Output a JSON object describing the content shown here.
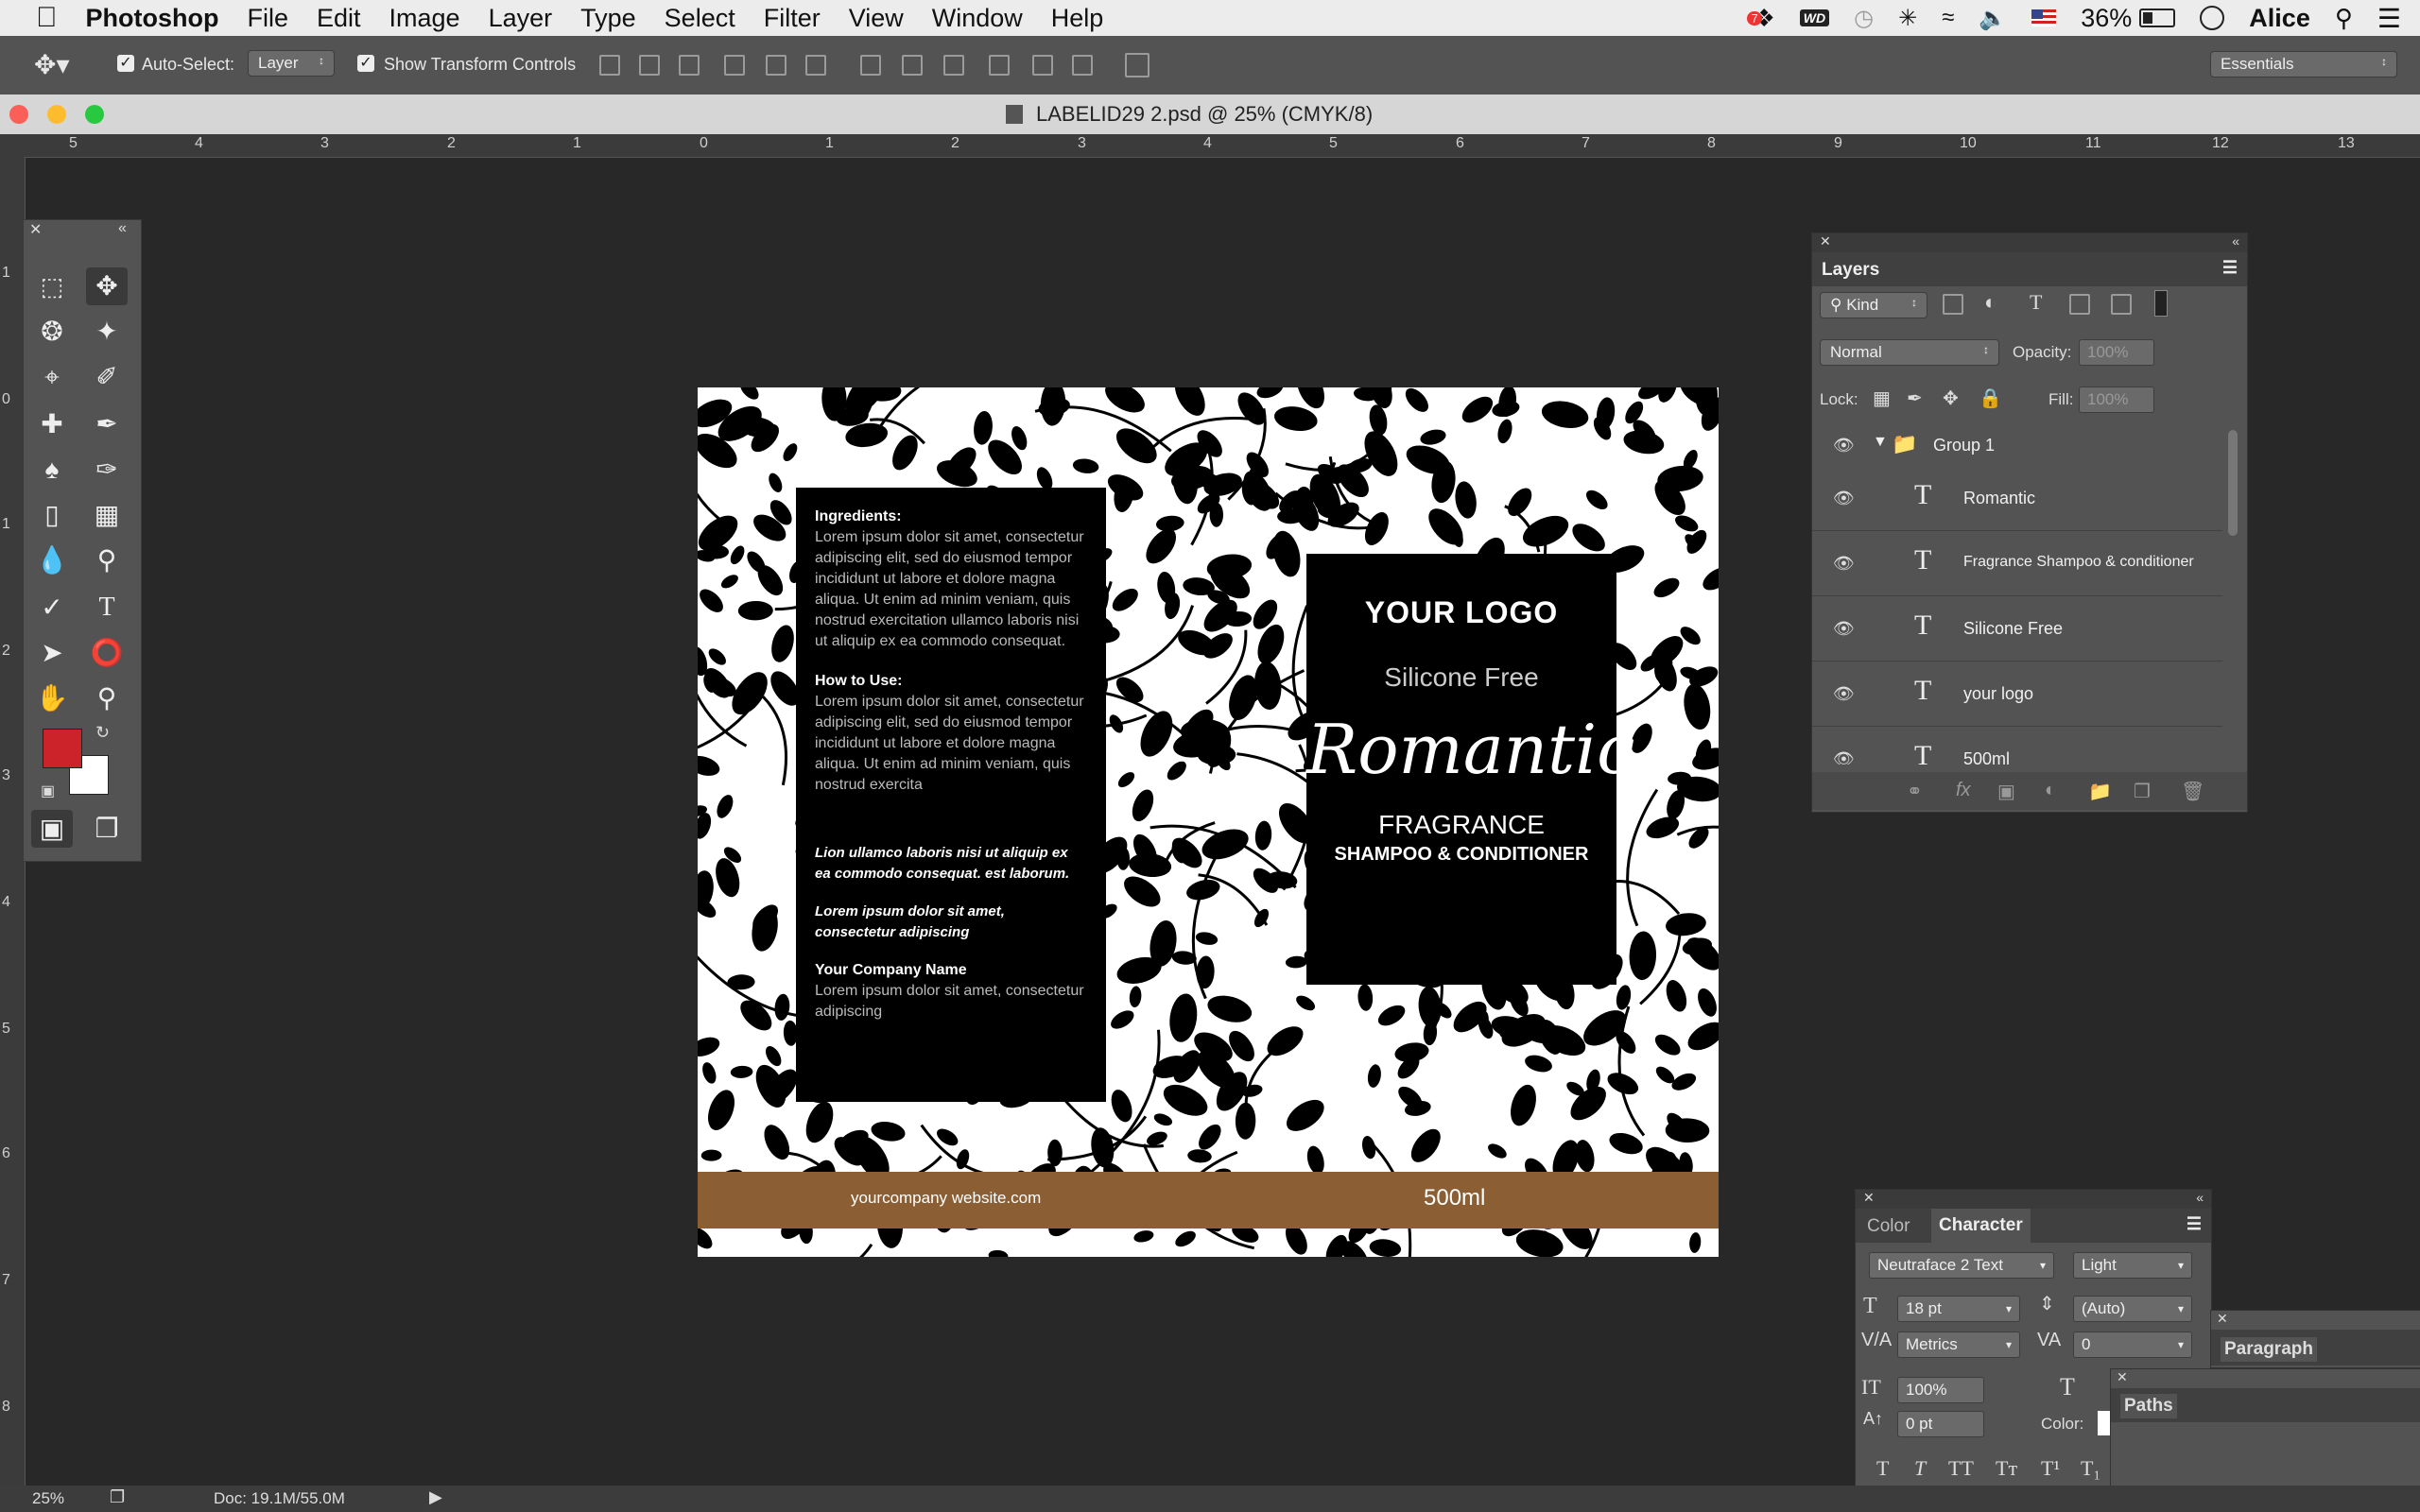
{
  "menubar": {
    "app_name": "Photoshop",
    "items": [
      "File",
      "Edit",
      "Image",
      "Layer",
      "Type",
      "Select",
      "Filter",
      "View",
      "Window",
      "Help"
    ],
    "battery": "36%",
    "user": "Alice",
    "badge_count": "7",
    "wd_label": "WD"
  },
  "options_bar": {
    "auto_select_label": "Auto-Select:",
    "auto_select_value": "Layer",
    "show_transform_label": "Show Transform Controls",
    "workspace": "Essentials"
  },
  "document": {
    "title": "LABELID29 2.psd @ 25% (CMYK/8)"
  },
  "rulers": {
    "horizontal": [
      "5",
      "4",
      "3",
      "2",
      "1",
      "0",
      "1",
      "2",
      "3",
      "4",
      "5",
      "6",
      "7",
      "8",
      "9",
      "10",
      "11",
      "12",
      "13"
    ],
    "vertical": [
      "1",
      "0",
      "1",
      "2",
      "3",
      "4",
      "5",
      "6",
      "7",
      "8"
    ]
  },
  "label": {
    "left": {
      "ingredients_heading": "Ingredients:",
      "ingredients_text": "Lorem ipsum dolor sit amet, consectetur adipiscing elit, sed do eiusmod tempor incididunt ut labore et dolore magna aliqua. Ut enim ad minim veniam, quis nostrud exercitation ullamco laboris nisi ut aliquip ex ea commodo consequat.",
      "howto_heading": "How to Use:",
      "howto_text": "Lorem ipsum dolor sit amet, consectetur adipiscing elit, sed do eiusmod tempor incididunt ut labore et dolore magna aliqua. Ut enim ad minim veniam, quis nostrud exercita",
      "italic1": "Lion ullamco laboris nisi ut aliquip ex ea commodo consequat. est laborum.",
      "italic2": "Lorem ipsum dolor sit amet, consectetur adipiscing",
      "company_heading": "Your Company Name",
      "company_text": "Lorem ipsum dolor sit amet, consectetur adipiscing"
    },
    "right": {
      "logo": "YOUR LOGO",
      "silicone": "Silicone Free",
      "romantic": "Romantic",
      "fragrance": "FRAGRANCE",
      "shampoo": "SHAMPOO & CONDITIONER"
    },
    "bar": {
      "website": "yourcompany website.com",
      "volume": "500ml",
      "color": "#8b5e34"
    }
  },
  "layers_panel": {
    "title": "Layers",
    "filter_kind": "Kind",
    "blend_mode": "Normal",
    "opacity_label": "Opacity:",
    "opacity_value": "100%",
    "lock_label": "Lock:",
    "fill_label": "Fill:",
    "fill_value": "100%",
    "group_name": "Group 1",
    "layers": [
      "Romantic",
      "Fragrance Shampoo & conditioner",
      "Silicone Free",
      "your logo",
      "500ml"
    ]
  },
  "character_panel": {
    "tab_color": "Color",
    "tab_character": "Character",
    "font_family": "Neutraface 2 Text",
    "font_style": "Light",
    "size": "18 pt",
    "leading": "(Auto)",
    "kerning": "Metrics",
    "tracking": "0",
    "vertical_scale": "100%",
    "baseline": "0 pt",
    "color_label": "Color:"
  },
  "paragraph_panel": {
    "title": "Paragraph"
  },
  "paths_panel": {
    "title": "Paths"
  },
  "status": {
    "zoom": "25%",
    "doc_info": "Doc: 19.1M/55.0M"
  },
  "colors": {
    "foreground": "#cc2229",
    "background": "#ffffff"
  }
}
